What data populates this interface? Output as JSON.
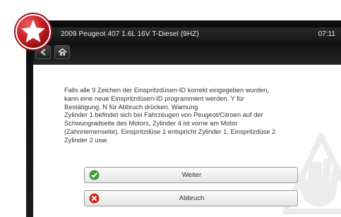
{
  "header": {
    "vehicle_title": "2009 Peugeot 407 1.6L 16V T-Diesel  (9HZ)",
    "time": "07:11"
  },
  "message": {
    "text": "Falls alle 9 Zeichen der Einspritzdüsen-ID korrekt eingegeben wurden,\nkann eine neue Einspritzdüsen-ID programmiert werden. Y für\nBestätigung, N für Abbruch drücken. Warnung\nZylinder 1 befindet sich bei Fahrzeugen von Peugeot/Citroen auf der\nSchwungradseite des Motors, Zylinder 4 ist vorne am Motor\n(Zahnriemenseite). Einspritzdüse 1 entspricht Zylinder 1, Einspritzdüse 2\nZylinder 2 usw."
  },
  "buttons": {
    "continue_label": "Weiter",
    "cancel_label": "Abbruch"
  },
  "icons": {
    "badge": "star-badge-icon",
    "back": "back-icon",
    "home": "home-icon",
    "continue": "check-icon",
    "cancel": "cancel-icon",
    "warning": "warning-hand-icon"
  },
  "colors": {
    "badge_red": "#c81f24",
    "continue_green": "#3b9a35",
    "cancel_red": "#d62020",
    "titlebar": "#1b1b1b"
  }
}
